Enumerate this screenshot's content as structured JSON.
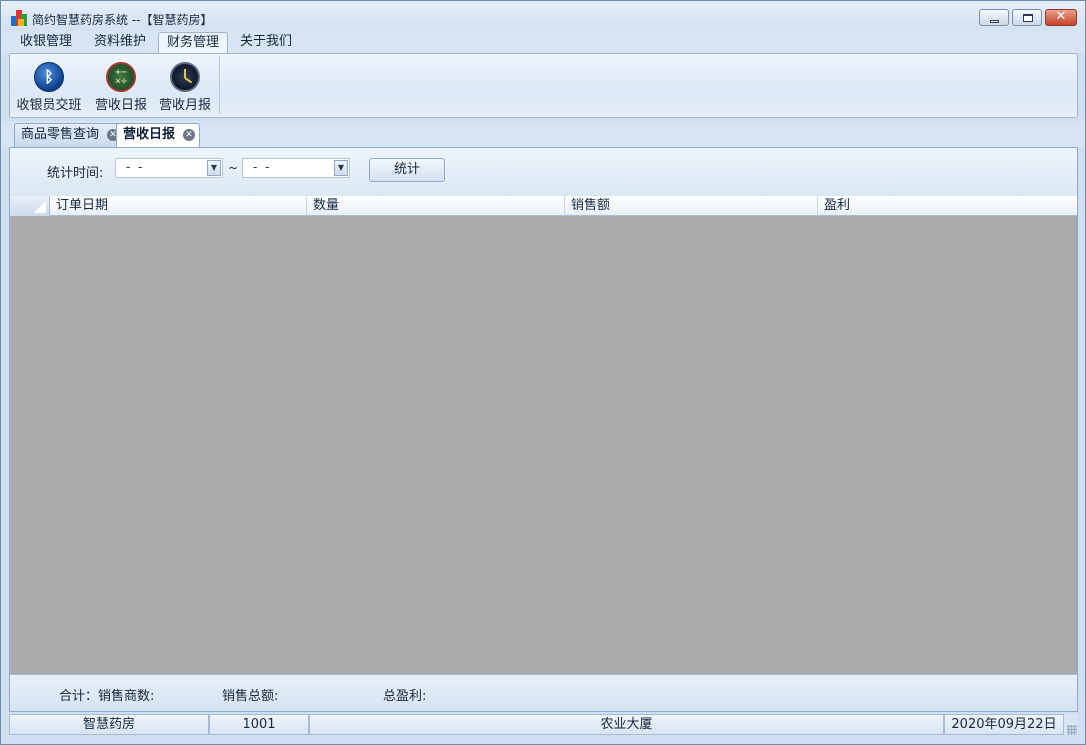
{
  "window": {
    "title": "简约智慧药房系统 --【智慧药房】",
    "buttons": {
      "minimize": "minimize-icon",
      "maximize": "maximize-icon",
      "close": "close-icon"
    }
  },
  "ribbon": {
    "tabs": [
      {
        "label": "收银管理"
      },
      {
        "label": "资料维护"
      },
      {
        "label": "财务管理",
        "active": true
      },
      {
        "label": "关于我们"
      }
    ],
    "buttons": [
      {
        "label": "收银员交班",
        "icon": "bluetooth-icon"
      },
      {
        "label": "营收日报",
        "icon": "calculator-icon"
      },
      {
        "label": "营收月报",
        "icon": "clock-icon"
      }
    ]
  },
  "doc_tabs": [
    {
      "label": "商品零售查询"
    },
    {
      "label": "营收日报",
      "active": true
    }
  ],
  "filter": {
    "label": "统计时间:",
    "start_date": "- -",
    "separator": "~",
    "end_date": "- -",
    "button": "统计"
  },
  "grid": {
    "columns": [
      "订单日期",
      "数量",
      "销售额",
      "盈利"
    ],
    "rows": []
  },
  "summary": {
    "total_label": "合计：销售商数:",
    "sales_total_label": "销售总额:",
    "profit_total_label": "总盈利:"
  },
  "status_bar": {
    "store": "智慧药房",
    "user_id": "1001",
    "location": "农业大厦",
    "date": "2020年09月22日"
  },
  "colors": {
    "chrome": "#d7e4f2",
    "grid_background": "#ababab",
    "border": "#8fa9ca"
  }
}
